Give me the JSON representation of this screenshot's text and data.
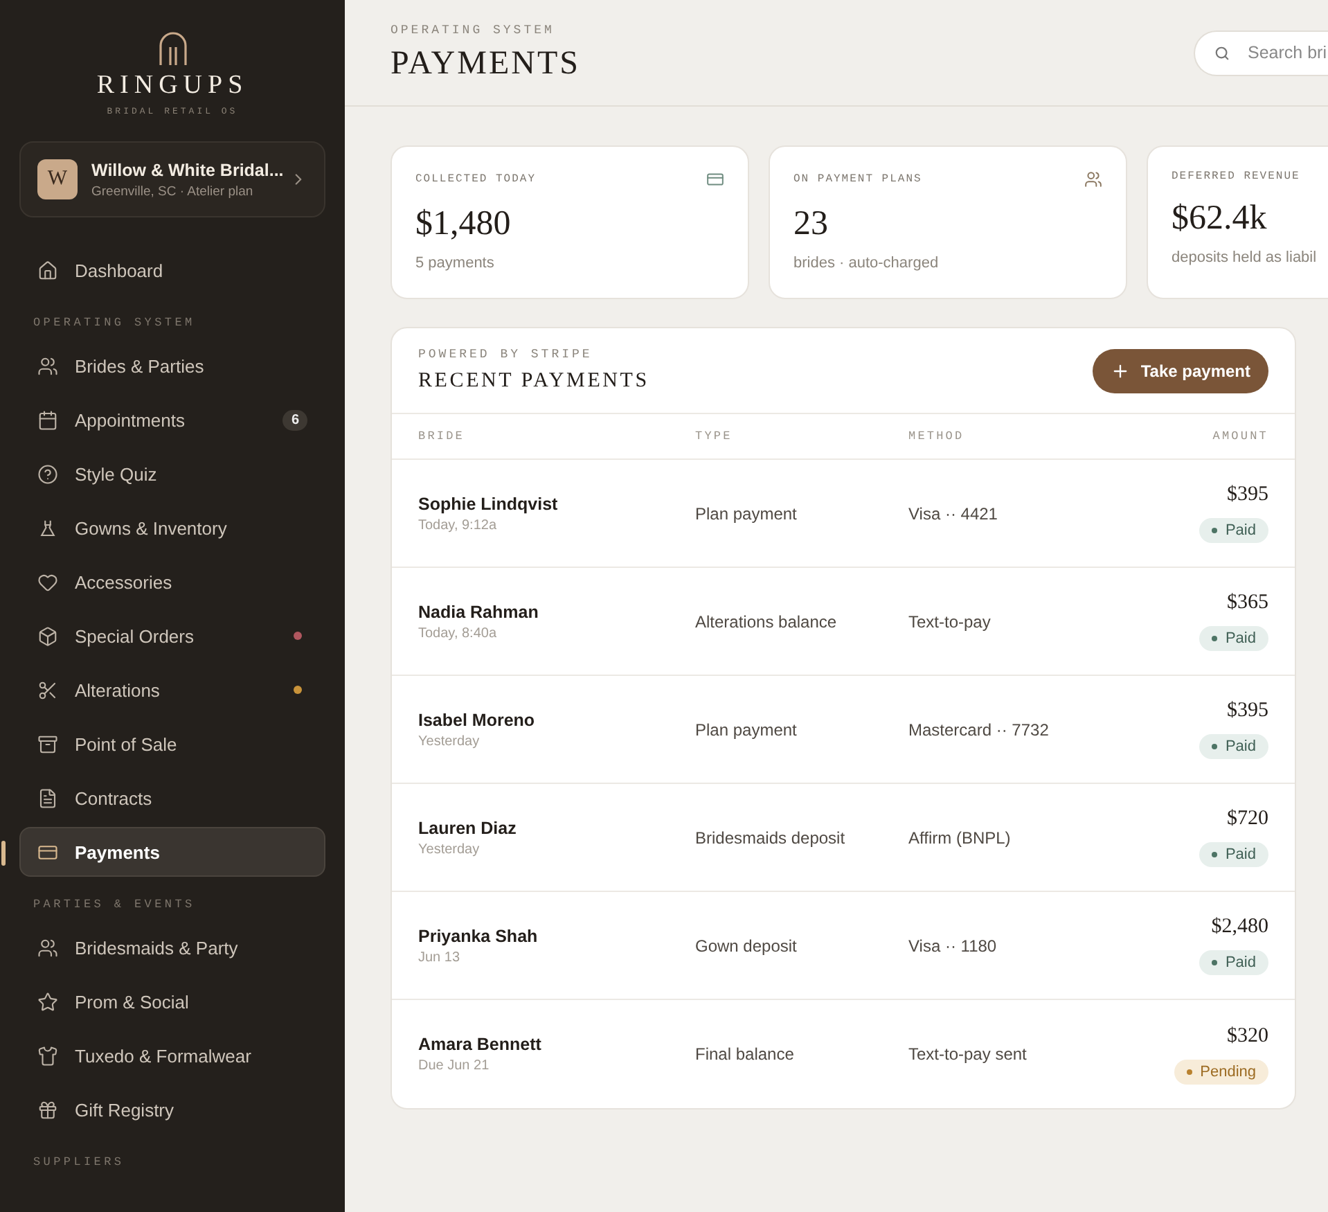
{
  "brand": {
    "name": "RINGUPS",
    "tagline": "BRIDAL RETAIL OS"
  },
  "store": {
    "initial": "W",
    "name": "Willow & White Bridal...",
    "detail": "Greenville, SC · Atelier plan"
  },
  "sidebar": {
    "items": [
      {
        "kind": "item",
        "label": "Dashboard",
        "selected": false
      },
      {
        "kind": "section",
        "label": "OPERATING SYSTEM"
      },
      {
        "kind": "item",
        "label": "Brides & Parties",
        "selected": false
      },
      {
        "kind": "item",
        "label": "Appointments",
        "selected": false,
        "badge": "6"
      },
      {
        "kind": "item",
        "label": "Style Quiz",
        "selected": false
      },
      {
        "kind": "item",
        "label": "Gowns & Inventory",
        "selected": false
      },
      {
        "kind": "item",
        "label": "Accessories",
        "selected": false
      },
      {
        "kind": "item",
        "label": "Special Orders",
        "selected": false,
        "color": "#b0575f"
      },
      {
        "kind": "item",
        "label": "Alterations",
        "selected": false,
        "color": "#c9933a"
      },
      {
        "kind": "item",
        "label": "Point of Sale",
        "selected": false
      },
      {
        "kind": "item",
        "label": "Contracts",
        "selected": false
      },
      {
        "kind": "item",
        "label": "Payments",
        "selected": true
      },
      {
        "kind": "section",
        "label": "PARTIES & EVENTS"
      },
      {
        "kind": "item",
        "label": "Bridesmaids & Party",
        "selected": false
      },
      {
        "kind": "item",
        "label": "Prom & Social",
        "selected": false
      },
      {
        "kind": "item",
        "label": "Tuxedo & Formalwear",
        "selected": false
      },
      {
        "kind": "item",
        "label": "Gift Registry",
        "selected": false
      },
      {
        "kind": "section",
        "label": "SUPPLIERS"
      }
    ]
  },
  "header": {
    "eyebrow": "OPERATING SYSTEM",
    "title": "PAYMENTS",
    "search": {
      "placeholder": "Search bri"
    }
  },
  "stats": [
    {
      "label": "COLLECTED TODAY",
      "value": "$1,480",
      "note": "5 payments"
    },
    {
      "label": "ON PAYMENT PLANS",
      "value": "23",
      "note": "brides · auto-charged"
    },
    {
      "label": "DEFERRED REVENUE",
      "value": "$62.4k",
      "note": "deposits held as liabil"
    }
  ],
  "panel": {
    "eyebrow": "POWERED BY STRIPE",
    "title": "RECENT PAYMENTS",
    "button": "Take payment",
    "columns": [
      "BRIDE",
      "TYPE",
      "METHOD",
      "AMOUNT"
    ],
    "rows": [
      {
        "bride": "Sophie Lindqvist",
        "when": "Today, 9:12a",
        "type": "Plan payment",
        "method": "Visa ·· 4421",
        "amount": "$395",
        "status": {
          "label": "Paid",
          "kind": "paid"
        }
      },
      {
        "bride": "Nadia Rahman",
        "when": "Today, 8:40a",
        "type": "Alterations balance",
        "method": "Text-to-pay",
        "amount": "$365",
        "status": {
          "label": "Paid",
          "kind": "paid"
        }
      },
      {
        "bride": "Isabel Moreno",
        "when": "Yesterday",
        "type": "Plan payment",
        "method": "Mastercard ·· 7732",
        "amount": "$395",
        "status": {
          "label": "Paid",
          "kind": "paid"
        }
      },
      {
        "bride": "Lauren Diaz",
        "when": "Yesterday",
        "type": "Bridesmaids deposit",
        "method": "Affirm (BNPL)",
        "amount": "$720",
        "status": {
          "label": "Paid",
          "kind": "paid"
        }
      },
      {
        "bride": "Priyanka Shah",
        "when": "Jun 13",
        "type": "Gown deposit",
        "method": "Visa ·· 1180",
        "amount": "$2,480",
        "status": {
          "label": "Paid",
          "kind": "paid"
        }
      },
      {
        "bride": "Amara Bennett",
        "when": "Due Jun 21",
        "type": "Final balance",
        "method": "Text-to-pay sent",
        "amount": "$320",
        "status": {
          "label": "Pending",
          "kind": "pending"
        }
      }
    ]
  }
}
